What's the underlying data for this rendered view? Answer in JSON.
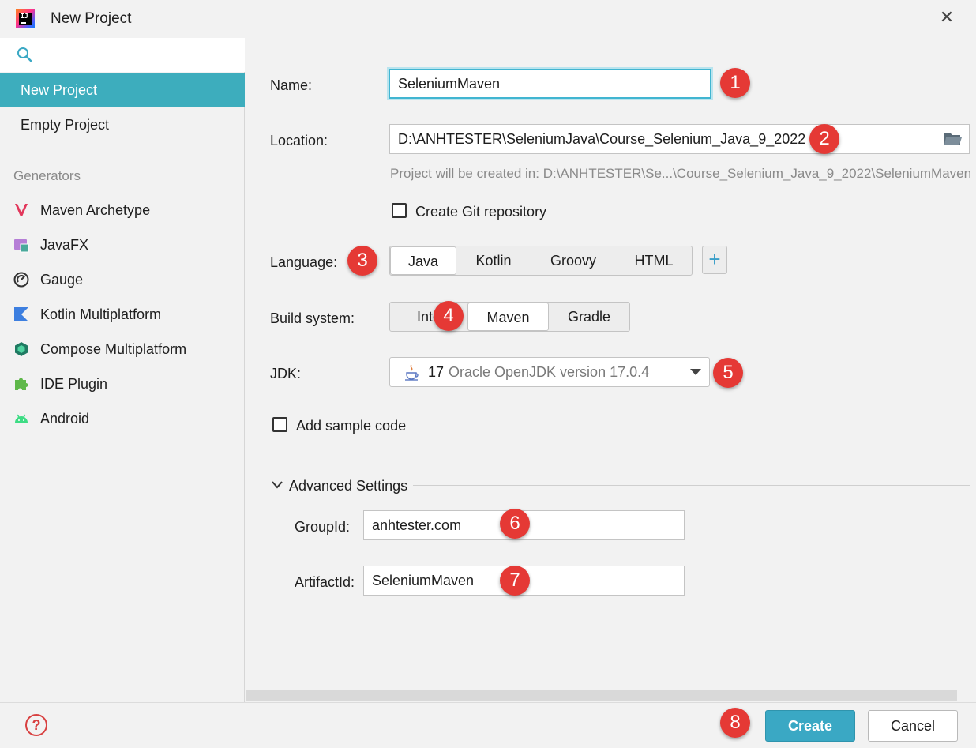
{
  "window": {
    "title": "New Project",
    "app_icon_text": "IJ"
  },
  "sidebar": {
    "search_placeholder": "",
    "top_items": [
      {
        "label": "New Project",
        "selected": true
      },
      {
        "label": "Empty Project",
        "selected": false
      }
    ],
    "generators_header": "Generators",
    "generators": [
      {
        "label": "Maven Archetype",
        "icon": "maven-icon"
      },
      {
        "label": "JavaFX",
        "icon": "javafx-icon"
      },
      {
        "label": "Gauge",
        "icon": "gauge-icon"
      },
      {
        "label": "Kotlin Multiplatform",
        "icon": "kotlin-icon"
      },
      {
        "label": "Compose Multiplatform",
        "icon": "compose-icon"
      },
      {
        "label": "IDE Plugin",
        "icon": "plugin-icon"
      },
      {
        "label": "Android",
        "icon": "android-icon"
      }
    ]
  },
  "form": {
    "name_label": "Name:",
    "name_value": "SeleniumMaven",
    "location_label": "Location:",
    "location_value": "D:\\ANHTESTER\\SeleniumJava\\Course_Selenium_Java_9_2022",
    "location_hint": "Project will be created in: D:\\ANHTESTER\\Se...\\Course_Selenium_Java_9_2022\\SeleniumMaven",
    "git_label": "Create Git repository",
    "language_label": "Language:",
    "languages": [
      "Java",
      "Kotlin",
      "Groovy",
      "HTML"
    ],
    "language_selected": "Java",
    "add_language": "+",
    "build_label": "Build system:",
    "build_systems": [
      "Inte",
      "Maven",
      "Gradle"
    ],
    "build_selected": "Maven",
    "jdk_label": "JDK:",
    "jdk_version": "17",
    "jdk_name": "Oracle OpenJDK version 17.0.4",
    "sample_label": "Add sample code",
    "advanced_label": "Advanced Settings",
    "groupid_label": "GroupId:",
    "groupid_value": "anhtester.com",
    "artifactid_label": "ArtifactId:",
    "artifactid_value": "SeleniumMaven"
  },
  "annotations": [
    "1",
    "2",
    "3",
    "4",
    "5",
    "6",
    "7",
    "8"
  ],
  "footer": {
    "help": "?",
    "create": "Create",
    "cancel": "Cancel"
  },
  "colors": {
    "accent": "#3dadbd",
    "badge": "#e53935",
    "focus": "#41b5d1"
  }
}
